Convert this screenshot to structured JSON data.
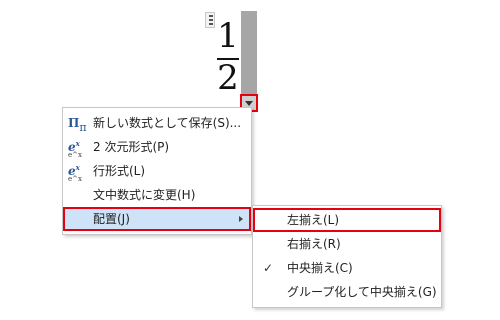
{
  "equation": {
    "numerator": "1",
    "denominator": "2"
  },
  "menu": {
    "items": [
      {
        "label": "新しい数式として保存(S)...",
        "icon": "save-equation-icon"
      },
      {
        "label": "2 次元形式(P)",
        "icon": "professional-format-icon"
      },
      {
        "label": "行形式(L)",
        "icon": "linear-format-icon"
      },
      {
        "label": "文中数式に変更(H)",
        "icon": ""
      },
      {
        "label": "配置(J)",
        "icon": "",
        "has_submenu": true,
        "highlighted": true
      }
    ]
  },
  "submenu": {
    "items": [
      {
        "label": "左揃え(L)",
        "checked": false,
        "boxed": true
      },
      {
        "label": "右揃え(R)",
        "checked": false
      },
      {
        "label": "中央揃え(C)",
        "checked": true
      },
      {
        "label": "グループ化して中央揃え(G)",
        "checked": false
      }
    ]
  },
  "colors": {
    "highlight_border": "#e50012",
    "selection_bg": "#cfe3f8",
    "accent": "#2b5797"
  }
}
